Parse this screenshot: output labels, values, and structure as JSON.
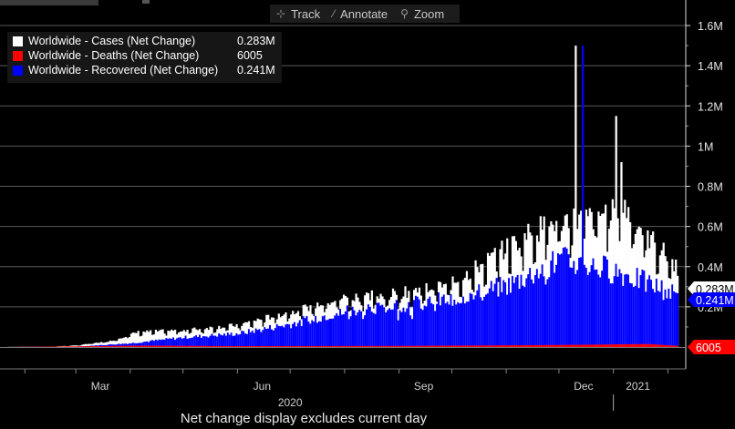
{
  "toolbar": {
    "track_label": "Track",
    "annotate_label": "Annotate",
    "zoom_label": "Zoom"
  },
  "legend": [
    {
      "name": "Worldwide - Cases (Net Change)",
      "value": "0.283M",
      "color": "#ffffff"
    },
    {
      "name": "Worldwide - Deaths (Net Change)",
      "value": "6005",
      "color": "#ff0000"
    },
    {
      "name": "Worldwide - Recovered (Net Change)",
      "value": "0.241M",
      "color": "#0000ff"
    }
  ],
  "footer_note": "Net change display excludes current day",
  "chart_data": {
    "type": "bar",
    "y_ticks": [
      "0.2M",
      "0.4M",
      "0.6M",
      "0.8M",
      "1M",
      "1.2M",
      "1.4M",
      "1.6M"
    ],
    "y_tick_values": [
      200000,
      400000,
      600000,
      800000,
      1000000,
      1200000,
      1400000,
      1600000
    ],
    "ylim": [
      0,
      1650000
    ],
    "grid": true,
    "x_month_labels": [
      "Mar",
      "Jun",
      "Sep",
      "Dec",
      "2021"
    ],
    "x_year_label": "2020",
    "last_value_tags": [
      {
        "series": "Cases",
        "label": "0.283M",
        "value": 283000
      },
      {
        "series": "Recovered",
        "label": "0.241M",
        "value": 241000
      },
      {
        "series": "Deaths",
        "label": "6005",
        "value": 6005
      }
    ],
    "series_anchors": {
      "cases": [
        {
          "date": "2020-01-22",
          "value": 500
        },
        {
          "date": "2020-02-15",
          "value": 2000
        },
        {
          "date": "2020-03-01",
          "value": 8000
        },
        {
          "date": "2020-03-20",
          "value": 30000
        },
        {
          "date": "2020-04-05",
          "value": 75000
        },
        {
          "date": "2020-05-01",
          "value": 85000
        },
        {
          "date": "2020-06-01",
          "value": 110000
        },
        {
          "date": "2020-07-01",
          "value": 180000
        },
        {
          "date": "2020-08-01",
          "value": 250000
        },
        {
          "date": "2020-09-01",
          "value": 270000
        },
        {
          "date": "2020-10-01",
          "value": 320000
        },
        {
          "date": "2020-10-25",
          "value": 460000
        },
        {
          "date": "2020-11-15",
          "value": 580000
        },
        {
          "date": "2020-12-01",
          "value": 640000
        },
        {
          "date": "2020-12-20",
          "value": 650000
        },
        {
          "date": "2021-01-05",
          "value": 720000
        },
        {
          "date": "2021-01-20",
          "value": 560000
        },
        {
          "date": "2021-02-06",
          "value": 400000
        }
      ],
      "recovered": [
        {
          "date": "2020-01-22",
          "value": 0
        },
        {
          "date": "2020-02-15",
          "value": 1500
        },
        {
          "date": "2020-03-01",
          "value": 2000
        },
        {
          "date": "2020-04-01",
          "value": 20000
        },
        {
          "date": "2020-05-01",
          "value": 50000
        },
        {
          "date": "2020-06-01",
          "value": 70000
        },
        {
          "date": "2020-07-01",
          "value": 120000
        },
        {
          "date": "2020-08-01",
          "value": 190000
        },
        {
          "date": "2020-09-01",
          "value": 220000
        },
        {
          "date": "2020-10-01",
          "value": 250000
        },
        {
          "date": "2020-11-01",
          "value": 320000
        },
        {
          "date": "2020-12-01",
          "value": 450000
        },
        {
          "date": "2021-01-01",
          "value": 400000
        },
        {
          "date": "2021-02-06",
          "value": 270000
        }
      ],
      "deaths": [
        {
          "date": "2020-01-22",
          "value": 0
        },
        {
          "date": "2020-04-10",
          "value": 7000
        },
        {
          "date": "2020-06-01",
          "value": 4500
        },
        {
          "date": "2020-09-01",
          "value": 5500
        },
        {
          "date": "2020-12-01",
          "value": 10000
        },
        {
          "date": "2021-01-20",
          "value": 15000
        },
        {
          "date": "2021-02-06",
          "value": 6005
        }
      ]
    },
    "spikes": [
      {
        "series": "cases",
        "date": "2020-12-10",
        "value": 1500000
      },
      {
        "series": "recovered",
        "date": "2020-12-14",
        "value": 1500000
      },
      {
        "series": "cases",
        "date": "2021-01-02",
        "value": 1150000
      },
      {
        "series": "cases",
        "date": "2021-01-05",
        "value": 920000
      }
    ],
    "x_start": "2020-01-22",
    "x_end": "2021-02-06"
  }
}
